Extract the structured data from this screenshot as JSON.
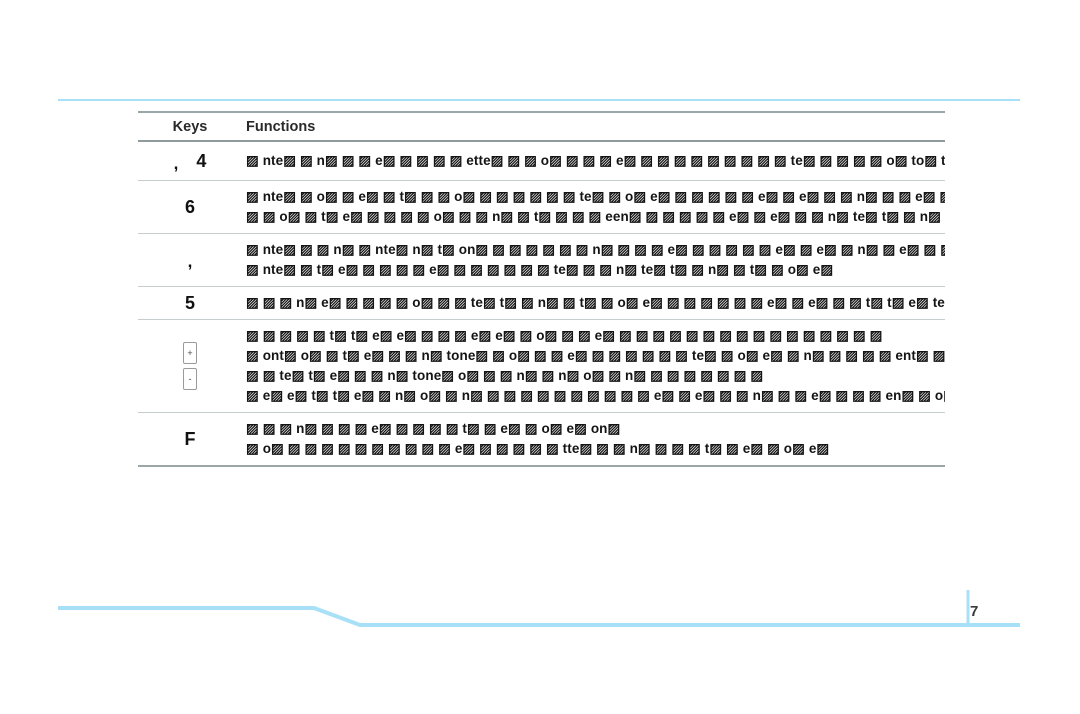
{
  "page": {
    "number": "7",
    "accent_color": "#a8e0f7",
    "rule_color": "#9aa6a8"
  },
  "table": {
    "headers": {
      "keys": "Keys",
      "functions": "Functions"
    },
    "rows": [
      {
        "key_type": "comma-number",
        "key_comma": ",",
        "key_label": "4",
        "lines": [
          "▨ nte▨ ▨ n▨ ▨ ▨ e▨ ▨ ▨ ▨ ▨ ette▨ ▨ ▨ o▨ ▨ ▨ ▨ e▨ ▨ ▨ ▨ ▨ ▨ ▨ ▨ ▨ ▨ te▨ ▨ ▨ ▨ ▨ o▨ to▨ t▨"
        ]
      },
      {
        "key_type": "number",
        "key_label": "6",
        "lines": [
          "▨ nte▨ ▨ o▨ ▨ e▨ ▨ t▨ ▨ ▨ o▨ ▨ ▨ ▨ ▨ ▨ ▨ te▨ ▨ o▨ e▨ ▨ ▨ ▨ ▨ ▨ e▨ ▨ e▨ ▨ ▨ n▨ ▨ ▨ e▨ ▨ ▨ ▨",
          "▨ ▨ o▨ ▨ t▨ e▨ ▨ ▨ ▨ ▨ o▨ ▨ ▨ n▨ ▨ t▨ ▨ ▨ ▨ een▨ ▨ ▨ ▨ ▨ ▨ e▨ ▨ e▨ ▨ ▨ n▨ te▨ t▨ ▨ n▨ ▨ t▨"
        ]
      },
      {
        "key_type": "comma",
        "key_label": ",",
        "lines": [
          "▨ nte▨ ▨ ▨ n▨ ▨ nte▨ n▨ t▨ on▨ ▨ ▨ ▨ ▨ ▨ ▨ n▨ ▨ ▨ ▨ e▨ ▨ ▨ ▨ ▨ ▨ e▨ ▨ e▨ ▨ n▨ ▨ e▨ ▨ ▨",
          "▨ nte▨ ▨ t▨ e▨ ▨ ▨ ▨ ▨ e▨ ▨ ▨ ▨ ▨ ▨ ▨ te▨ ▨ ▨ n▨ te▨ t▨ ▨ n▨ ▨ t▨ ▨ o▨ e▨"
        ]
      },
      {
        "key_type": "number",
        "key_label": "5",
        "lines": [
          "▨ ▨ ▨ n▨ e▨ ▨ ▨ ▨ ▨ o▨ ▨ ▨ te▨ t▨ ▨ n▨ ▨ t▨ ▨ o▨ e▨ ▨ ▨ ▨ ▨ ▨ ▨ e▨ ▨ e▨ ▨ ▨ t▨ t▨ e▨ te▨ t▨"
        ]
      },
      {
        "key_type": "plusminus-keycap",
        "key_plus": "+",
        "key_minus": "-",
        "lines": [
          "▨ ▨ ▨ ▨ ▨ t▨ t▨ e▨ e▨ ▨ ▨ ▨ e▨ e▨ ▨ o▨ ▨ ▨ e▨ ▨ ▨ ▨ ▨ ▨ ▨ ▨ ▨ ▨ ▨ ▨ ▨ ▨ ▨ ▨ ▨",
          "▨ ont▨ o▨ ▨ t▨ e▨ ▨ ▨ n▨ tone▨ ▨ o▨ ▨ ▨ e▨ ▨ ▨ ▨ ▨ ▨ ▨ te▨ ▨ o▨ e▨ ▨ n▨ ▨ ▨ ▨ ▨ ent▨ ▨ ▨ ▨",
          "▨ ▨ te▨ t▨ e▨ ▨ ▨ n▨ tone▨ o▨ ▨ ▨ n▨ ▨ n▨ o▨ ▨ n▨ ▨ ▨ ▨ ▨ ▨ ▨ ▨",
          "▨ e▨ e▨ t▨ t▨ e▨ ▨ n▨ o▨ ▨ n▨ ▨ ▨ ▨ ▨ ▨ ▨ ▨ ▨ ▨ ▨ e▨ ▨ e▨ ▨ ▨ n▨ ▨ ▨ e▨ ▨ ▨ ▨ en▨ ▨ o▨"
        ]
      },
      {
        "key_type": "letter",
        "key_label": "F",
        "lines": [
          "▨ ▨ ▨ n▨ ▨ ▨ ▨ e▨ ▨ ▨ ▨ ▨ t▨ ▨ e▨ ▨ o▨ e▨ on▨",
          "▨ o▨ ▨ ▨ ▨ ▨ ▨ ▨ ▨ ▨ ▨ ▨ e▨ ▨ ▨ ▨ ▨ ▨ tte▨ ▨ ▨ n▨ ▨ ▨ ▨ t▨ ▨ e▨ ▨ o▨ e▨"
        ]
      }
    ]
  }
}
